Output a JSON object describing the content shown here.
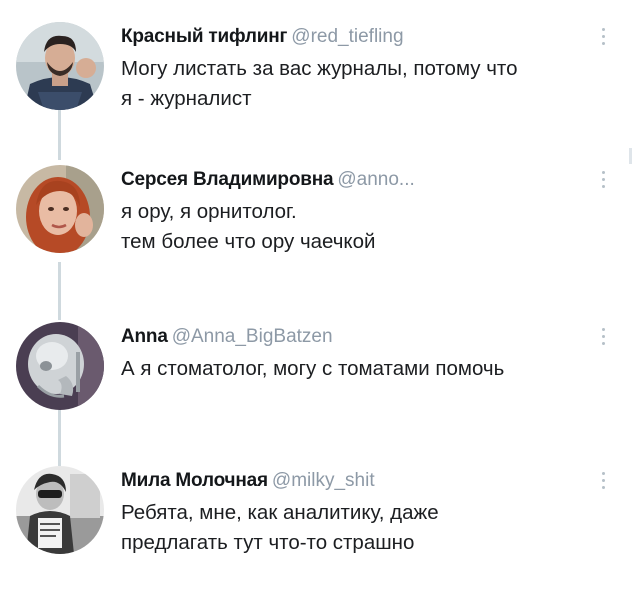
{
  "tweets": [
    {
      "name": "Красный тифлинг",
      "handle": "@red_tiefling",
      "lines": [
        "Могу листать за вас журналы, потому что",
        "я - журналист"
      ]
    },
    {
      "name": "Серсея Владимировна",
      "handle": "@anno...",
      "lines": [
        "я ору, я орнитолог.",
        "тем более что ору чаечкой"
      ]
    },
    {
      "name": "Anna",
      "handle": "@Anna_BigBatzen",
      "lines": [
        "А я стоматолог, могу с томатами помочь"
      ]
    },
    {
      "name": "Мила Молочная",
      "handle": "@milky_shit",
      "lines": [
        "Ребята, мне, как аналитику, даже",
        "предлагать тут что-то страшно"
      ]
    }
  ],
  "icons": {
    "more": "vertical-ellipsis-icon"
  },
  "colors": {
    "name": "#14171a",
    "handle": "#8d99a6",
    "thread_line": "#cfd9de"
  }
}
